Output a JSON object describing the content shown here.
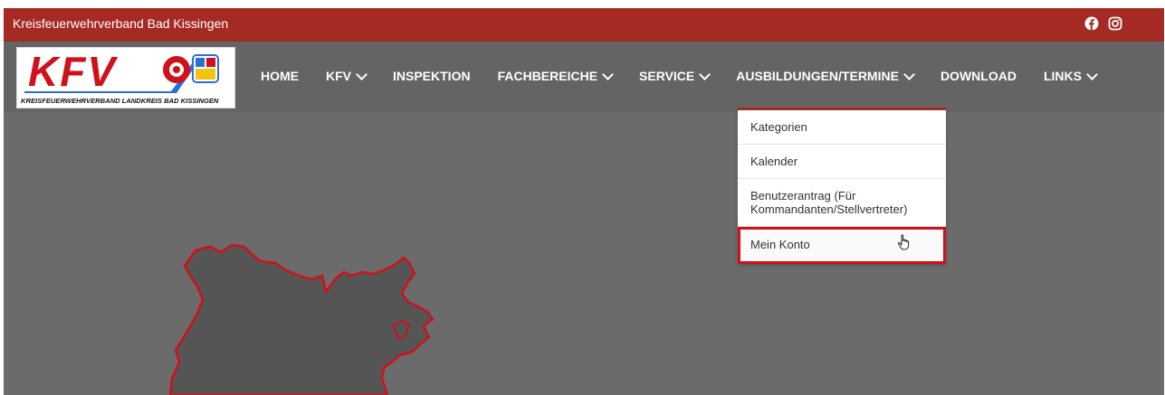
{
  "topbar": {
    "site_name": "Kreisfeuerwehrverband Bad Kissingen",
    "social": [
      "facebook-icon",
      "instagram-icon"
    ],
    "color": "#a52a23"
  },
  "logo": {
    "letters": "KFV",
    "subtitle": "KREISFEUERWEHRVERBAND LANDKREIS BAD KISSINGEN"
  },
  "nav": {
    "items": [
      {
        "label": "HOME",
        "dropdown": false
      },
      {
        "label": "KFV",
        "dropdown": true
      },
      {
        "label": "INSPEKTION",
        "dropdown": false
      },
      {
        "label": "FACHBEREICHE",
        "dropdown": true
      },
      {
        "label": "SERVICE",
        "dropdown": true
      },
      {
        "label": "AUSBILDUNGEN/TERMINE",
        "dropdown": true
      },
      {
        "label": "DOWNLOAD",
        "dropdown": false
      },
      {
        "label": "LINKS",
        "dropdown": true
      }
    ]
  },
  "dropdown": {
    "items": [
      {
        "label": "Kategorien"
      },
      {
        "label": "Kalender"
      },
      {
        "label": "Benutzerantrag (Für Kommandanten/Stellvertreter)"
      },
      {
        "label": "Mein Konto",
        "highlighted": true
      }
    ]
  },
  "colors": {
    "background": "#6b6b6b",
    "map_fill": "#555555",
    "map_outline": "#d0101a",
    "highlight": "#d0101a"
  }
}
